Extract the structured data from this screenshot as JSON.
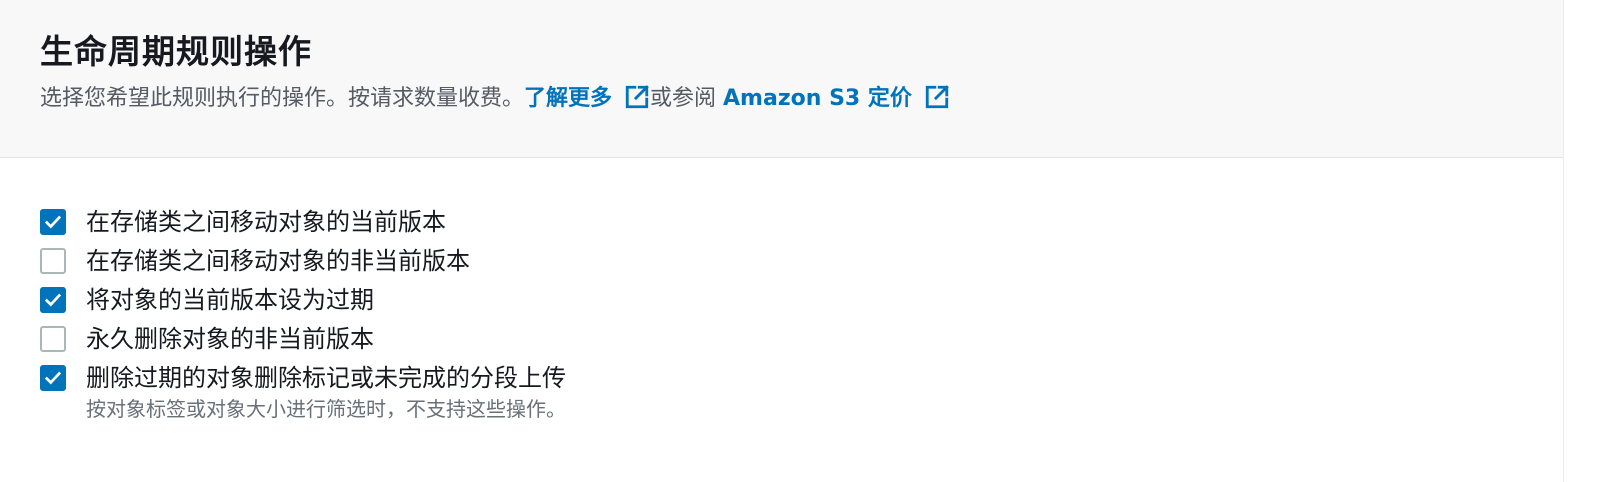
{
  "header": {
    "title": "生命周期规则操作",
    "description_text": "选择您希望此规则执行的操作。按请求数量收费。",
    "learn_more_link": "了解更多",
    "or_see_text": "或参阅 ",
    "pricing_link": "Amazon S3 定价",
    "external_icon": "external-link-icon"
  },
  "actions": {
    "items": [
      {
        "label": "在存储类之间移动对象的当前版本",
        "checked": true
      },
      {
        "label": "在存储类之间移动对象的非当前版本",
        "checked": false
      },
      {
        "label": "将对象的当前版本设为过期",
        "checked": true
      },
      {
        "label": "永久删除对象的非当前版本",
        "checked": false
      },
      {
        "label": "删除过期的对象删除标记或未完成的分段上传",
        "checked": true
      }
    ],
    "note": "按对象标签或对象大小进行筛选时，不支持这些操作。"
  },
  "colors": {
    "accent": "#0073bb",
    "header_bg": "#f8f8f8",
    "unchecked_border": "#aab7b8"
  }
}
